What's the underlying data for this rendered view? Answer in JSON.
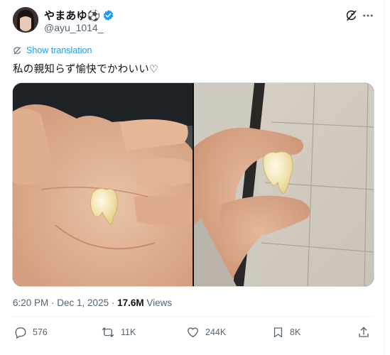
{
  "author": {
    "display_name": "やまあゆ⚽",
    "handle": "@ayu_1014_",
    "verified_badge": "blue-check-icon"
  },
  "translate": {
    "label": "Show translation"
  },
  "tweet": {
    "text": "私の親知らず愉快でかわいい♡"
  },
  "media": {
    "photos": [
      {
        "name": "hand-holding-tooth-photo"
      },
      {
        "name": "fingers-pinching-tooth-photo"
      }
    ]
  },
  "meta": {
    "time": "6:20 PM",
    "separator": " · ",
    "date": "Dec 1, 2025",
    "separator2": " · ",
    "views_count": "17.6M",
    "views_label": " Views"
  },
  "actions": {
    "replies": "576",
    "reposts": "11K",
    "likes": "244K",
    "bookmarks": "8K"
  },
  "colors": {
    "accent": "#1d9bf0",
    "muted": "#536471",
    "text": "#0f1419",
    "border": "#cfd9de"
  }
}
